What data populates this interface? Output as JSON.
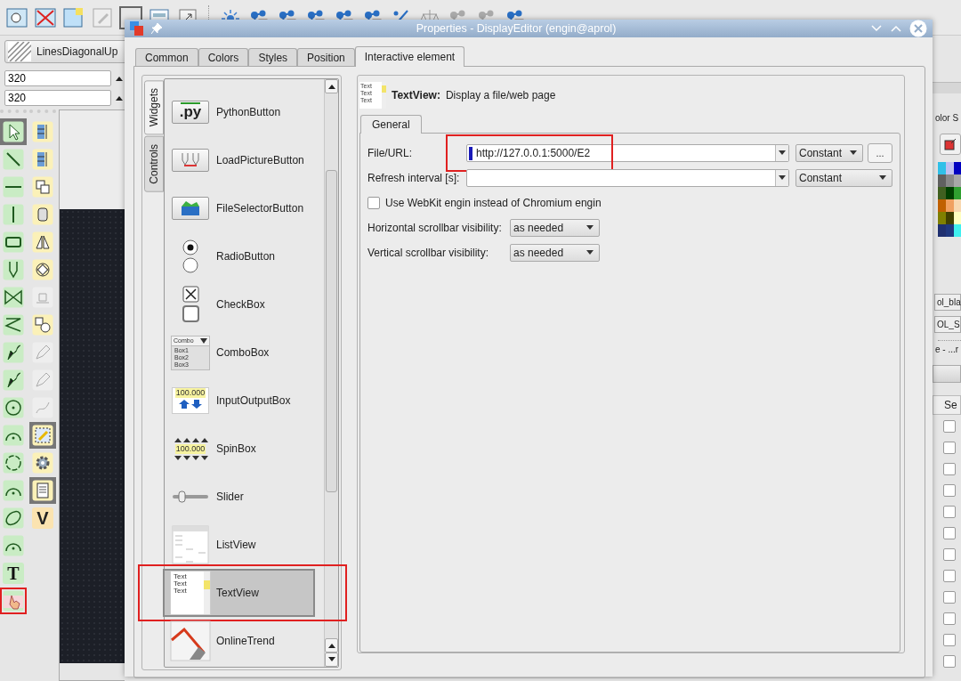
{
  "left_panel": {
    "fill_pattern": "LinesDiagonalUp",
    "spin_values": [
      "320",
      "320"
    ],
    "tools_column_1": [
      {
        "kind": "pointer",
        "selected": true,
        "highlighted": false
      },
      {
        "kind": "line",
        "selected": false,
        "highlighted": false
      },
      {
        "kind": "hline",
        "selected": false,
        "highlighted": false
      },
      {
        "kind": "vline",
        "selected": false,
        "highlighted": false
      },
      {
        "kind": "rect",
        "selected": false,
        "highlighted": false
      },
      {
        "kind": "pipe",
        "selected": false,
        "highlighted": false
      },
      {
        "kind": "bowtie",
        "selected": false,
        "highlighted": false
      },
      {
        "kind": "zigzag",
        "selected": false,
        "highlighted": false
      },
      {
        "kind": "pen",
        "selected": false,
        "highlighted": false
      },
      {
        "kind": "pen",
        "selected": false,
        "highlighted": false
      },
      {
        "kind": "circle",
        "selected": false,
        "highlighted": false
      },
      {
        "kind": "arc",
        "selected": false,
        "highlighted": false
      },
      {
        "kind": "ring",
        "selected": false,
        "highlighted": false
      },
      {
        "kind": "arc",
        "selected": false,
        "highlighted": false
      },
      {
        "kind": "ellipse",
        "selected": false,
        "highlighted": false
      },
      {
        "kind": "arc",
        "selected": false,
        "highlighted": false
      },
      {
        "kind": "glyph",
        "text": "T",
        "selected": false,
        "highlighted": false
      },
      {
        "kind": "hand",
        "selected": false,
        "highlighted": true
      }
    ],
    "tools_column_2": [
      {
        "kind": "align",
        "disabled": false,
        "selected": false
      },
      {
        "kind": "align",
        "disabled": false,
        "selected": false
      },
      {
        "kind": "layers",
        "disabled": false,
        "selected": false
      },
      {
        "kind": "cylinder",
        "disabled": false,
        "selected": false
      },
      {
        "kind": "mirror",
        "disabled": false,
        "selected": false
      },
      {
        "kind": "rotate",
        "disabled": false,
        "selected": false
      },
      {
        "kind": "stack",
        "disabled": true,
        "selected": false
      },
      {
        "kind": "group",
        "disabled": false,
        "selected": false
      },
      {
        "kind": "edit",
        "disabled": true,
        "selected": false
      },
      {
        "kind": "edit",
        "disabled": true,
        "selected": false
      },
      {
        "kind": "path",
        "disabled": true,
        "selected": false
      },
      {
        "kind": "select",
        "disabled": false,
        "selected": true
      },
      {
        "kind": "gear",
        "disabled": false,
        "selected": false
      },
      {
        "kind": "document",
        "disabled": false,
        "selected": true
      },
      {
        "kind": "glyph",
        "text": "V",
        "disabled": false,
        "selected": false
      }
    ]
  },
  "right_strip": {
    "heading": "olor S",
    "swatches": [
      {
        "color": "#30c0e8"
      },
      {
        "color": "#c0c0f0"
      },
      {
        "color": "#0000c0"
      },
      {
        "color": "#606060"
      },
      {
        "color": "#888888"
      },
      {
        "color": "#a8a8a8"
      },
      {
        "color": "#406020"
      },
      {
        "color": "#004000"
      },
      {
        "color": "#30a030"
      },
      {
        "color": "#c06000"
      },
      {
        "color": "#f0a060"
      },
      {
        "color": "#f8d8b0"
      },
      {
        "color": "#808000"
      },
      {
        "color": "#404000"
      },
      {
        "color": "#ffffc0"
      },
      {
        "color": "#203070"
      },
      {
        "color": "#203880"
      },
      {
        "color": "#40f0f0"
      }
    ],
    "texts": [
      "ol_bla",
      "OL_S",
      "e - ...r"
    ],
    "column_header": "Se",
    "rows": [
      {
        "checked": false
      },
      {
        "checked": false
      },
      {
        "checked": false
      },
      {
        "checked": false
      },
      {
        "checked": false
      },
      {
        "checked": false
      },
      {
        "checked": false
      },
      {
        "checked": false
      },
      {
        "checked": false
      },
      {
        "checked": false
      },
      {
        "checked": false
      },
      {
        "checked": false
      }
    ]
  },
  "dialog": {
    "title": "Properties - DisplayEditor (engin@aprol)",
    "tabs": [
      {
        "label": "Common",
        "selected": false
      },
      {
        "label": "Colors",
        "selected": false
      },
      {
        "label": "Styles",
        "selected": false
      },
      {
        "label": "Position",
        "selected": false
      },
      {
        "label": "Interactive element",
        "selected": true
      }
    ],
    "side_tabs": [
      {
        "label": "Widgets",
        "selected": true
      },
      {
        "label": "Controls",
        "selected": false
      }
    ],
    "widgets": [
      {
        "kind": "python",
        "label": "PythonButton",
        "preview_text": [
          ".py"
        ],
        "selected": false,
        "highlighted": false
      },
      {
        "kind": "loadpicture",
        "label": "LoadPictureButton",
        "selected": false,
        "highlighted": false
      },
      {
        "kind": "fileselector",
        "label": "FileSelectorButton",
        "selected": false,
        "highlighted": false
      },
      {
        "kind": "radio",
        "label": "RadioButton",
        "selected": false,
        "highlighted": false
      },
      {
        "kind": "checkbox",
        "label": "CheckBox",
        "selected": false,
        "highlighted": false
      },
      {
        "kind": "combo",
        "label": "ComboBox",
        "preview_text": [
          "Combo",
          "Box1",
          "Box2",
          "Box3"
        ],
        "selected": false,
        "highlighted": false
      },
      {
        "kind": "inputoutput",
        "label": "InputOutputBox",
        "preview_text": [
          "100.000"
        ],
        "selected": false,
        "highlighted": false
      },
      {
        "kind": "spinbox",
        "label": "SpinBox",
        "preview_text": [
          "100.000"
        ],
        "selected": false,
        "highlighted": false
      },
      {
        "kind": "slider",
        "label": "Slider",
        "selected": false,
        "highlighted": false
      },
      {
        "kind": "listview",
        "label": "ListView",
        "selected": false,
        "highlighted": false
      },
      {
        "kind": "textview",
        "label": "TextView",
        "preview_text": [
          "Text",
          "Text",
          "Text"
        ],
        "selected": true,
        "highlighted": true
      },
      {
        "kind": "trend",
        "label": "OnlineTrend",
        "selected": false,
        "highlighted": false
      }
    ],
    "header": {
      "name": "TextView:",
      "description": "Display a file/web page",
      "icon_text": [
        "Text",
        "Text",
        "Text"
      ]
    },
    "sub_tabs": [
      {
        "label": "General",
        "selected": true
      }
    ],
    "fields": [
      {
        "kind": "url",
        "label": "File/URL:",
        "value": "http://127.0.0.1:5000/E2",
        "mode": "Constant",
        "browse": "...",
        "highlighted": true
      },
      {
        "kind": "combo",
        "label": "Refresh interval [s]:",
        "mode": "Constant",
        "highlighted": false
      },
      {
        "kind": "checkbox",
        "label": "Use WebKit engin instead of Chromium engin",
        "checked": false
      },
      {
        "kind": "select",
        "label": "Horizontal scrollbar visibility:",
        "value": "as needed"
      },
      {
        "kind": "select",
        "label": "Vertical scrollbar visibility:",
        "value": "as needed"
      }
    ]
  }
}
